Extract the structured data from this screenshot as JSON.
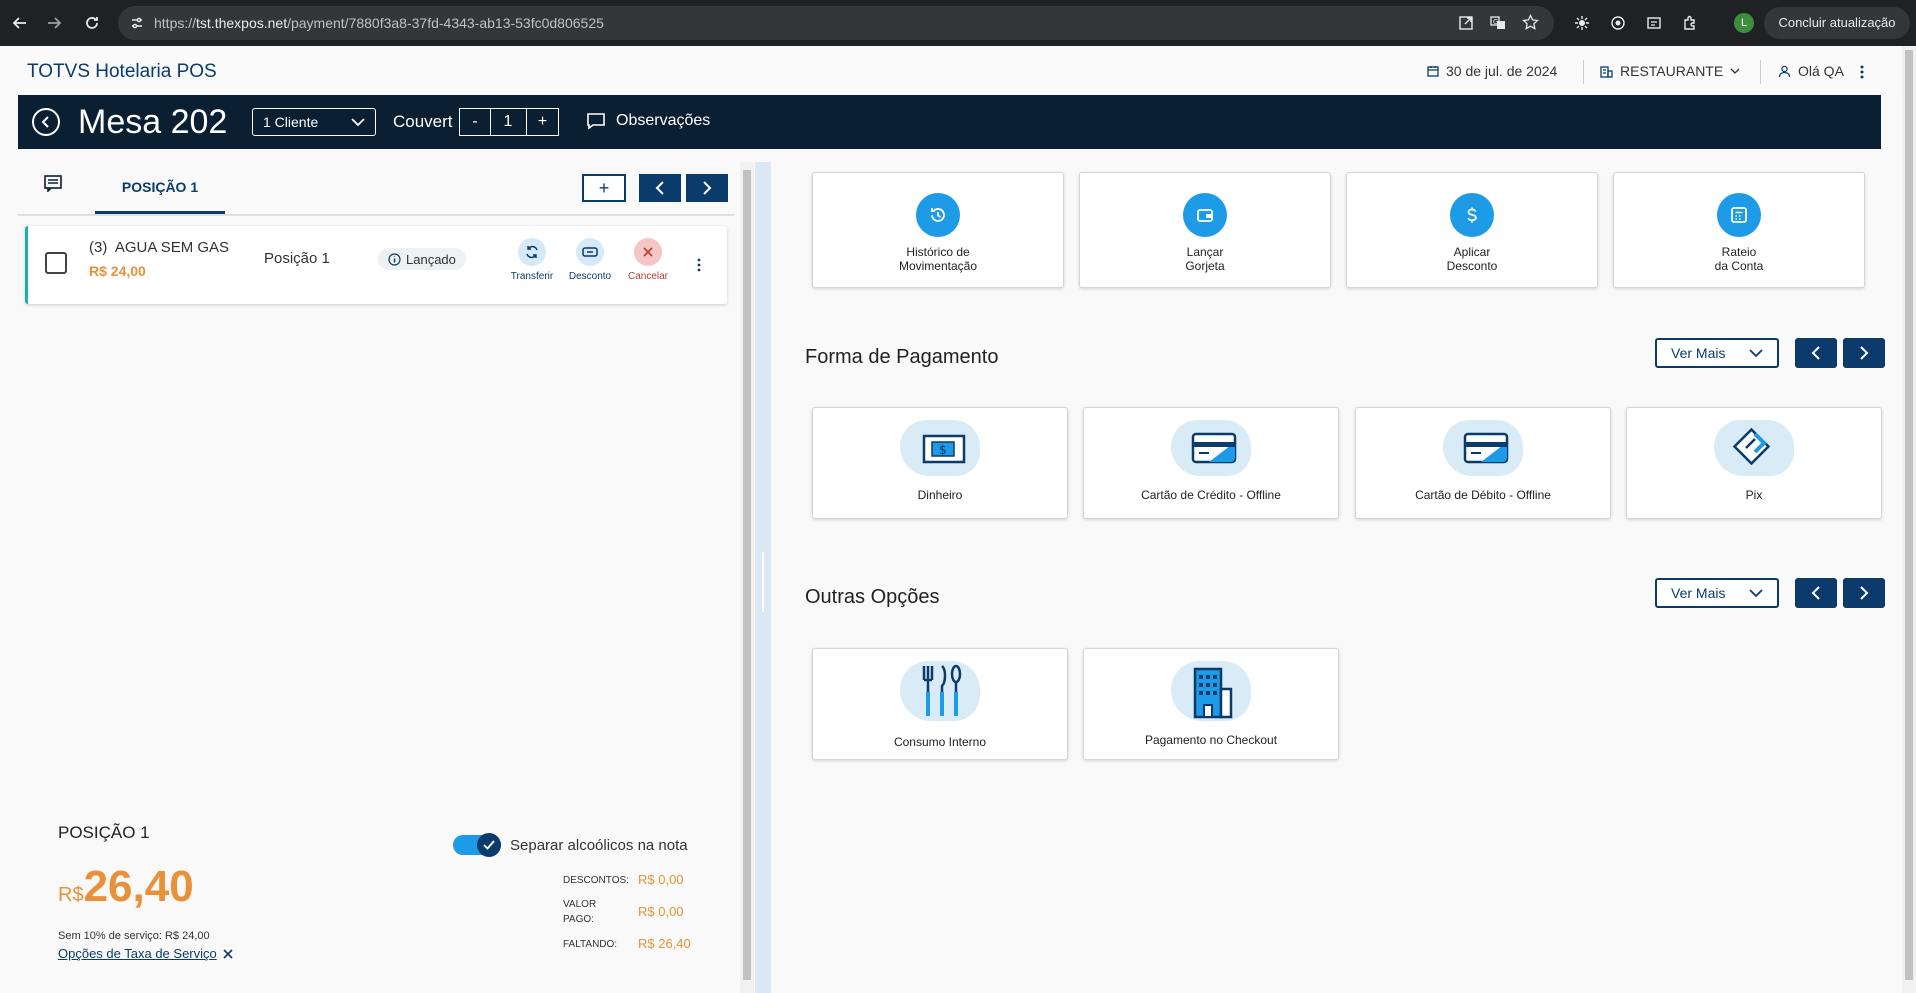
{
  "browser": {
    "url_prefix": "https://",
    "url_host": "tst.thexpos.net",
    "url_path": "/payment/7880f3a8-37fd-4343-ab13-53fc0d806525",
    "profile_initial": "L",
    "update_label": "Concluir atualização"
  },
  "header": {
    "app_title": "TOTVS Hotelaria POS",
    "date": "30 de jul. de 2024",
    "outlet": "RESTAURANTE",
    "greeting": "Olá QA"
  },
  "mesa": {
    "title": "Mesa 202",
    "cliente": "1 Cliente",
    "couvert_label": "Couvert",
    "couvert_minus": "-",
    "couvert_value": "1",
    "couvert_plus": "+",
    "observacoes": "Observações"
  },
  "tabs": {
    "position_tab": "POSIÇÃO 1",
    "add_label": "+"
  },
  "item": {
    "qty_name": "(3)  AGUA SEM GAS",
    "price": "R$ 24,00",
    "position": "Posição 1",
    "status": "Lançado",
    "actions": {
      "transfer": "Transferir",
      "discount": "Desconto",
      "cancel": "Cancelar"
    }
  },
  "summary": {
    "title": "POSIÇÃO 1",
    "currency": "R$",
    "total": "26,40",
    "service_note": "Sem 10% de serviço: R$ 24,00",
    "service_link": "Opções de Taxa de Serviço",
    "toggle_label": "Separar alcoólicos na nota",
    "toggle_on": true,
    "descontos_label": "DESCONTOS:",
    "descontos_value": "R$ 0,00",
    "pago_label_1": "VALOR",
    "pago_label_2": "PAGO:",
    "pago_value": "R$ 0,00",
    "faltando_label": "FALTANDO:",
    "faltando_value": "R$ 26,40"
  },
  "quick_actions": [
    {
      "line1": "Histórico de",
      "line2": "Movimentação",
      "icon": "history-icon"
    },
    {
      "line1": "Lançar",
      "line2": "Gorjeta",
      "icon": "wallet-icon"
    },
    {
      "line1": "Aplicar",
      "line2": "Desconto",
      "icon": "dollar-icon"
    },
    {
      "line1": "Rateio",
      "line2": "da Conta",
      "icon": "calculator-icon"
    }
  ],
  "payment": {
    "title": "Forma de Pagamento",
    "ver_mais": "Ver Mais",
    "methods": [
      "Dinheiro",
      "Cartão de Crédito - Offline",
      "Cartão de Débito - Offline",
      "Pix"
    ]
  },
  "others": {
    "title": "Outras Opções",
    "ver_mais": "Ver Mais",
    "options": [
      "Consumo Interno",
      "Pagamento no Checkout"
    ]
  },
  "colors": {
    "brand_navy": "#0b1f33",
    "brand_blue": "#0b3b6b",
    "accent_orange": "#e9913a",
    "icon_blue": "#1d9be6"
  }
}
